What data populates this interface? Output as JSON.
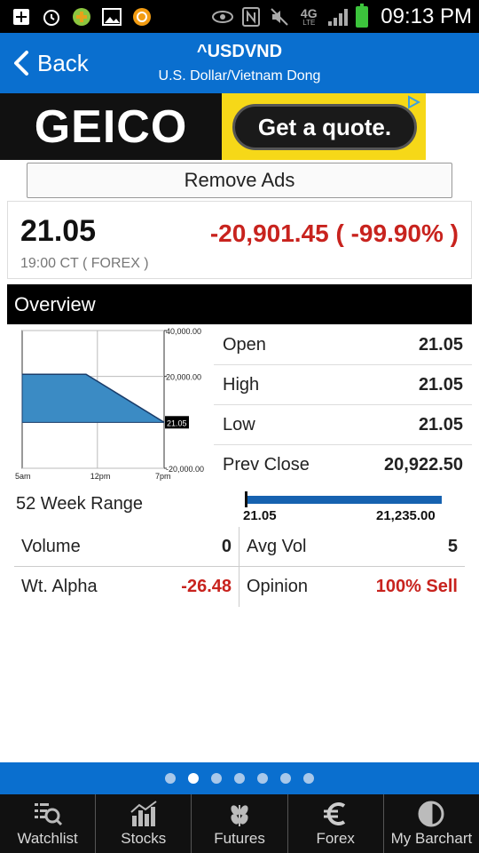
{
  "status_bar": {
    "time": "09:13 PM",
    "network": "4G",
    "network_sub": "LTE",
    "icons_left": [
      "add-icon",
      "alarm-icon",
      "app-icon",
      "gallery-icon",
      "sync-icon"
    ],
    "icons_right": [
      "eye-icon",
      "nfc-icon",
      "mute-icon",
      "signal-icon",
      "battery-icon"
    ]
  },
  "header": {
    "back_label": "Back",
    "title": "^USDVND",
    "subtitle": "U.S. Dollar/Vietnam Dong",
    "background": "#0a6fcf"
  },
  "ad": {
    "brand": "GEICO",
    "cta": "Get a quote.",
    "remove_label": "Remove Ads"
  },
  "quote": {
    "last": "21.05",
    "change": "-20,901.45 ( -99.90% )",
    "time": "19:00 CT ( FOREX )",
    "change_color": "#c8231e"
  },
  "overview": {
    "section_title": "Overview",
    "stats": [
      {
        "label": "Open",
        "value": "21.05"
      },
      {
        "label": "High",
        "value": "21.05"
      },
      {
        "label": "Low",
        "value": "21.05"
      },
      {
        "label": "Prev Close",
        "value": "20,922.50"
      }
    ],
    "range": {
      "label": "52 Week Range",
      "low": "21.05",
      "high": "21,235.00",
      "position": 0.0
    },
    "grid": [
      [
        {
          "label": "Volume",
          "value": "0",
          "negative": false
        },
        {
          "label": "Avg Vol",
          "value": "5",
          "negative": false
        }
      ],
      [
        {
          "label": "Wt. Alpha",
          "value": "-26.48",
          "negative": true
        },
        {
          "label": "Opinion",
          "value": "100% Sell",
          "negative": true
        }
      ]
    ]
  },
  "chart_data": {
    "type": "area",
    "x_ticks": [
      "5am",
      "12pm",
      "7pm"
    ],
    "y_ticks": [
      "40,000.00",
      "20,000.00",
      "-20,000.00"
    ],
    "y_ticks_values": [
      40000,
      20000,
      -20000
    ],
    "current_label": "21.05",
    "ylim": [
      -20000,
      40000
    ],
    "series": [
      {
        "x": [
          0,
          0.45,
          1.0
        ],
        "values": [
          20922.5,
          20922.5,
          21.05
        ]
      }
    ],
    "area_color": "#3b8bc4"
  },
  "pager": {
    "count": 7,
    "active": 1
  },
  "tabs": [
    {
      "label": "Watchlist",
      "icon": "watchlist-icon"
    },
    {
      "label": "Stocks",
      "icon": "stocks-icon"
    },
    {
      "label": "Futures",
      "icon": "futures-icon"
    },
    {
      "label": "Forex",
      "icon": "forex-icon"
    },
    {
      "label": "My Barchart",
      "icon": "barchart-icon"
    }
  ]
}
